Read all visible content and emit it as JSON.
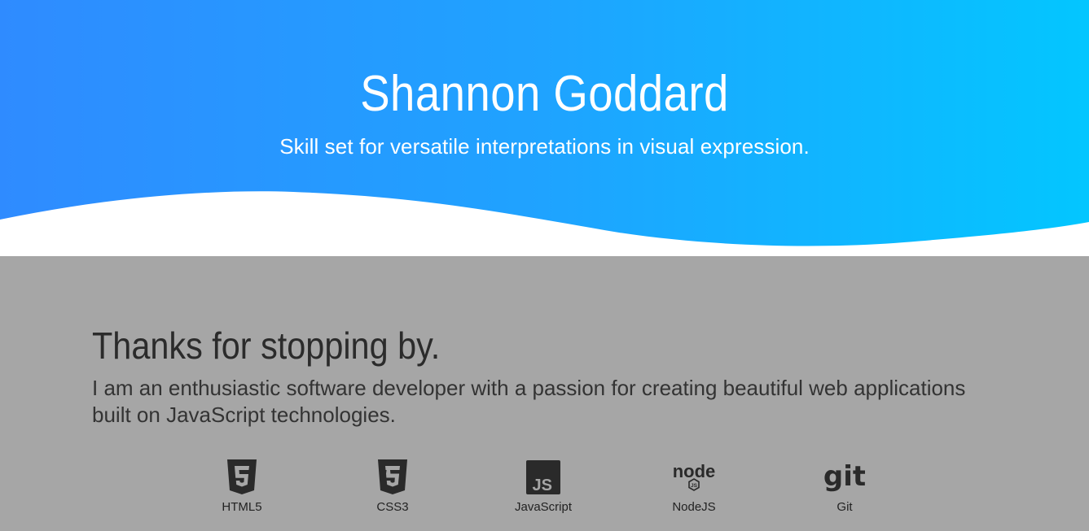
{
  "hero": {
    "title": "Shannon Goddard",
    "subtitle": "Skill set for versatile interpretations in visual expression.",
    "gradient_start": "#2f8bff",
    "gradient_end": "#03c6ff"
  },
  "about": {
    "heading": "Thanks for stopping by.",
    "body": "I am an enthusiastic software developer with a passion for creating beautiful web applications built on JavaScript technologies.",
    "background": "#a6a6a6"
  },
  "skills": [
    {
      "label": "HTML5",
      "icon": "html5-icon"
    },
    {
      "label": "CSS3",
      "icon": "css3-icon"
    },
    {
      "label": "JavaScript",
      "icon": "javascript-icon"
    },
    {
      "label": "NodeJS",
      "icon": "nodejs-icon"
    },
    {
      "label": "Git",
      "icon": "git-icon"
    }
  ]
}
